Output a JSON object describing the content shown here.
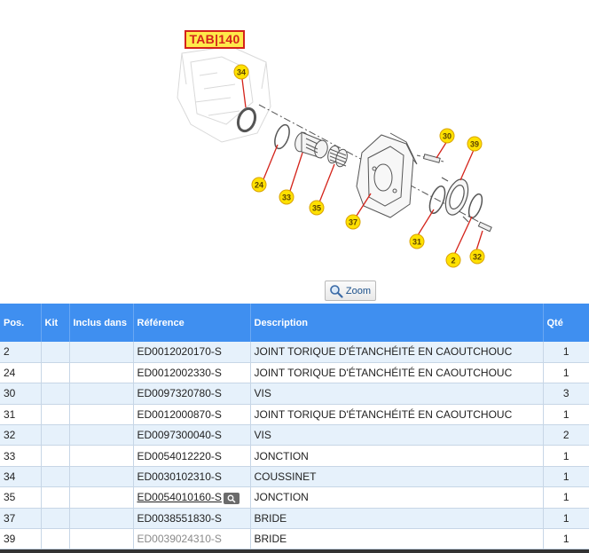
{
  "diagram": {
    "tab_label": "TAB|140",
    "callouts": [
      "34",
      "24",
      "33",
      "35",
      "37",
      "30",
      "39",
      "31",
      "2",
      "32"
    ]
  },
  "zoom": {
    "label": "Zoom"
  },
  "table": {
    "headers": {
      "pos": "Pos.",
      "kit": "Kit",
      "inclus": "Inclus dans",
      "reference": "Référence",
      "description": "Description",
      "qty": "Qté"
    },
    "rows": [
      {
        "pos": "2",
        "kit": "",
        "inclus": "",
        "reference": "ED0012020170-S",
        "description": "JOINT TORIQUE D'ÉTANCHÉITÉ EN CAOUTCHOUC",
        "qty": "1"
      },
      {
        "pos": "24",
        "kit": "",
        "inclus": "",
        "reference": "ED0012002330-S",
        "description": "JOINT TORIQUE D'ÉTANCHÉITÉ EN CAOUTCHOUC",
        "qty": "1"
      },
      {
        "pos": "30",
        "kit": "",
        "inclus": "",
        "reference": "ED0097320780-S",
        "description": "VIS",
        "qty": "3"
      },
      {
        "pos": "31",
        "kit": "",
        "inclus": "",
        "reference": "ED0012000870-S",
        "description": "JOINT TORIQUE D'ÉTANCHÉITÉ EN CAOUTCHOUC",
        "qty": "1"
      },
      {
        "pos": "32",
        "kit": "",
        "inclus": "",
        "reference": "ED0097300040-S",
        "description": "VIS",
        "qty": "2"
      },
      {
        "pos": "33",
        "kit": "",
        "inclus": "",
        "reference": "ED0054012220-S",
        "description": "JONCTION",
        "qty": "1"
      },
      {
        "pos": "34",
        "kit": "",
        "inclus": "",
        "reference": "ED0030102310-S",
        "description": "COUSSINET",
        "qty": "1"
      },
      {
        "pos": "35",
        "kit": "",
        "inclus": "",
        "reference": "ED0054010160-S",
        "description": "JONCTION",
        "qty": "1"
      },
      {
        "pos": "37",
        "kit": "",
        "inclus": "",
        "reference": "ED0038551830-S",
        "description": "BRIDE",
        "qty": "1"
      },
      {
        "pos": "39",
        "kit": "",
        "inclus": "",
        "reference": "ED0039024310-S",
        "description": "BRIDE",
        "qty": "1"
      }
    ]
  }
}
